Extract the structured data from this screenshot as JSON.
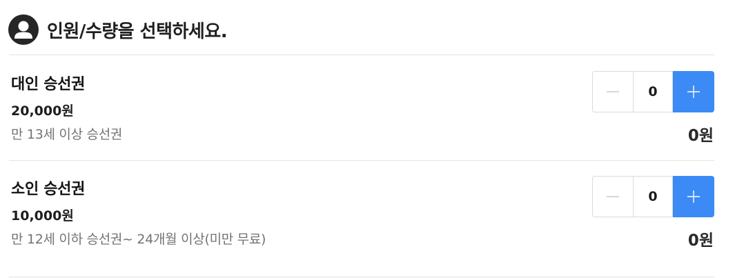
{
  "section": {
    "icon": "person-icon",
    "title": "인원/수량을 선택하세요."
  },
  "tickets": [
    {
      "name": "대인 승선권",
      "price": "20,000원",
      "description": "만 13세 이상 승선권",
      "quantity": "0",
      "total": "0원"
    },
    {
      "name": "소인 승선권",
      "price": "10,000원",
      "description": "만 12세 이하 승선권~ 24개월 이상(미만 무료)",
      "quantity": "0",
      "total": "0원"
    }
  ],
  "stepper": {
    "minus_icon": "minus-icon",
    "plus_icon": "plus-icon"
  },
  "colors": {
    "accent": "#3b8af5",
    "icon_bg": "#262626",
    "divider": "#e2e2e2",
    "muted_text": "#737373"
  }
}
